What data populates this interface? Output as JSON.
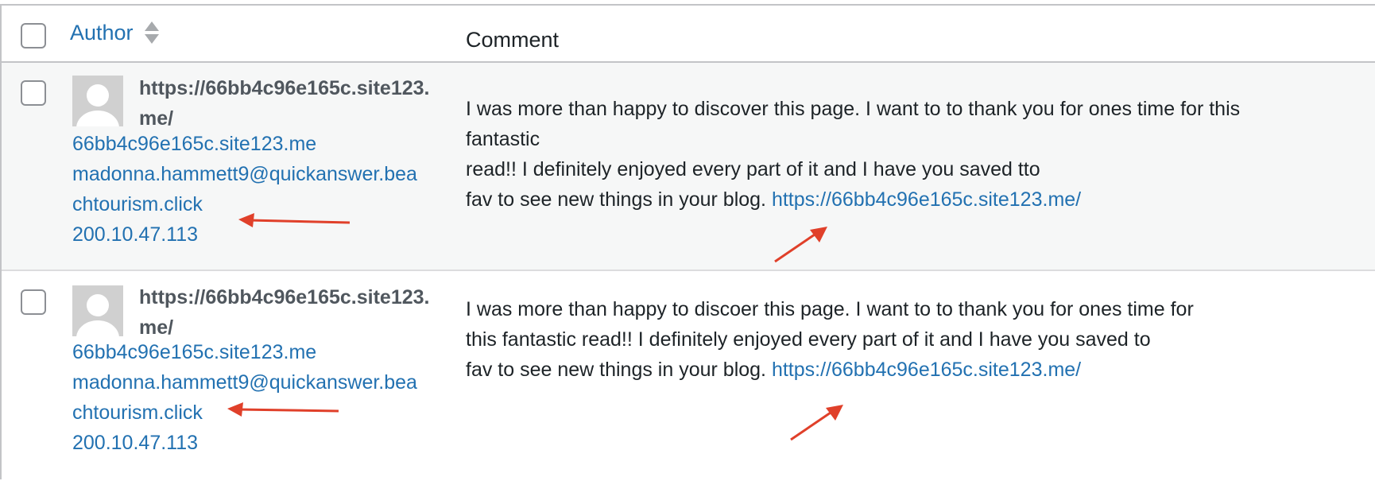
{
  "header": {
    "author_label": "Author",
    "comment_label": "Comment"
  },
  "rows": [
    {
      "author_name": "https://66bb4c96e165c.site123.me/",
      "author_url": "66bb4c96e165c.site123.me",
      "author_email": "madonna.hammett9@quickanswer.beachtourism.click",
      "author_ip": "200.10.47.113",
      "comment_lines": [
        "I was more than happy to discover this page. I want to to thank you for ones time for this",
        "fantastic",
        "read!! I definitely enjoyed every part of it and I have you saved tto",
        "fav to see new things in your blog. "
      ],
      "comment_link": "https://66bb4c96e165c.site123.me/"
    },
    {
      "author_name": "https://66bb4c96e165c.site123.me/",
      "author_url": "66bb4c96e165c.site123.me",
      "author_email": "madonna.hammett9@quickanswer.beachtourism.click",
      "author_ip": "200.10.47.113",
      "comment_lines": [
        "I was more than happy to discoer this page. I want to to thank you for ones time for",
        "this fantastic read!! I definitely enjoyed every part of it and I have you saved to",
        "fav to see new things in your blog. "
      ],
      "comment_link": "https://66bb4c96e165c.site123.me/"
    }
  ],
  "colors": {
    "link": "#2271b1",
    "annotation_arrow": "#e0402a",
    "row_alt_bg": "#f6f7f7"
  },
  "icons": {
    "sort": "sort-arrows-icon",
    "avatar": "default-avatar-icon"
  }
}
